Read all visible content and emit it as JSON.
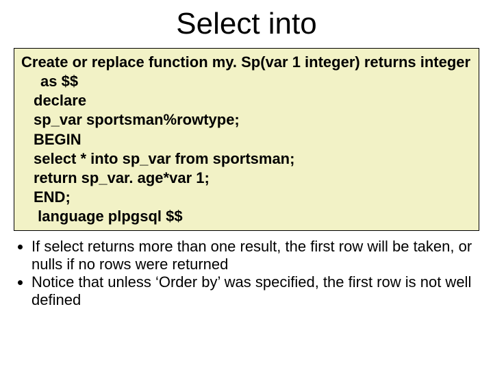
{
  "title": "Select into",
  "code": {
    "l1": "Create or replace function my. Sp(var 1 integer) returns integer as $$",
    "l2": "declare",
    "l3": "sp_var sportsman%rowtype;",
    "l4": "BEGIN",
    "l5": "select * into sp_var from sportsman;",
    "l6": "return sp_var. age*var 1;",
    "l7": "END;",
    "l8": " language plpgsql $$"
  },
  "bullets": {
    "b1": "If select returns more than one result, the first row will be taken, or nulls if no rows were returned",
    "b2": "Notice that unless ‘Order by’ was specified, the first row is not well defined"
  }
}
